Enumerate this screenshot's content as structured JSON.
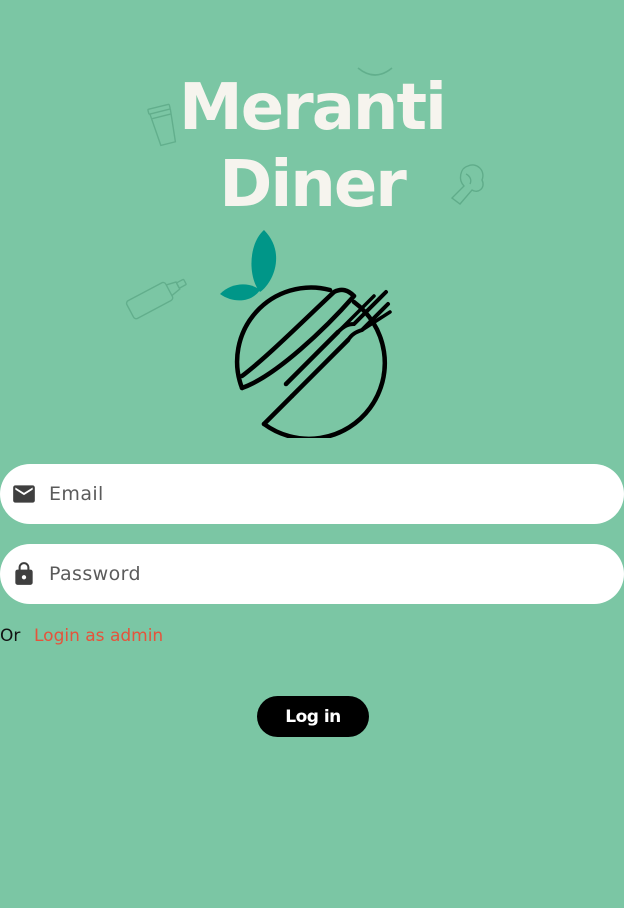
{
  "app": {
    "title_line1": "Meranti",
    "title_line2": "Diner"
  },
  "form": {
    "email": {
      "placeholder": "Email",
      "value": "",
      "icon": "mail-icon"
    },
    "password": {
      "placeholder": "Password",
      "value": "",
      "icon": "lock-icon"
    }
  },
  "alt_login": {
    "prefix": "Or",
    "link_label": "Login as admin"
  },
  "actions": {
    "login_label": "Log in"
  },
  "colors": {
    "background": "#7bc6a4",
    "title": "#f6f4ee",
    "leaf": "#009688",
    "link": "#e5533b",
    "button": "#000000"
  }
}
